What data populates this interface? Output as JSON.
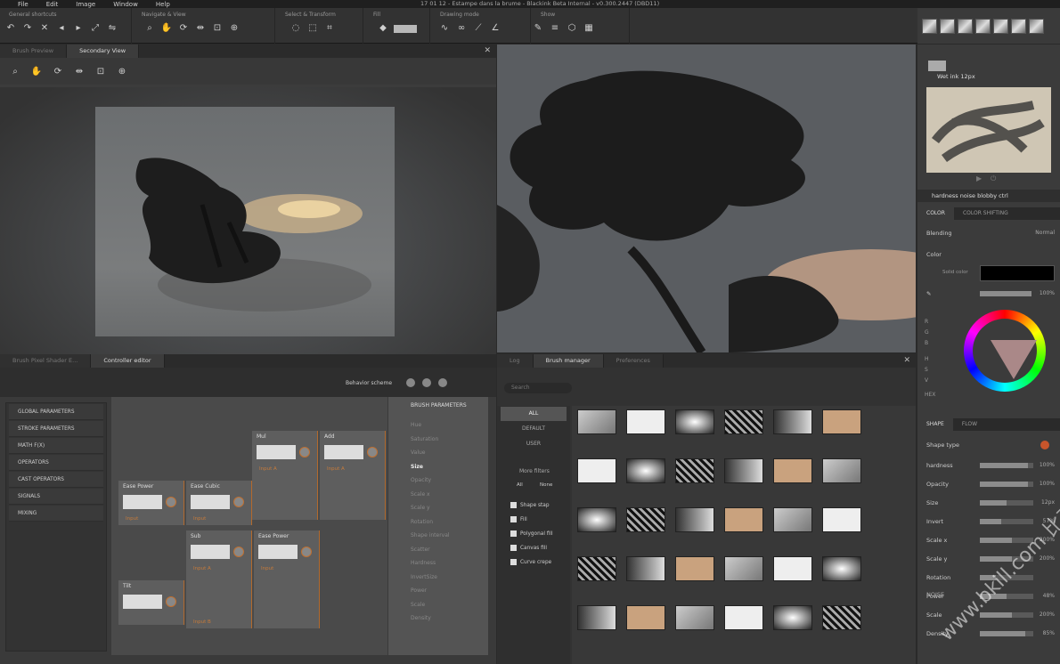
{
  "menu": {
    "items": [
      "File",
      "Edit",
      "Image",
      "Window",
      "Help"
    ],
    "title": "17 01 12 - Estampe dans la brume - Blackink Beta Internal - v0.300.2447 (DBD11)"
  },
  "toolbar": {
    "groups": [
      "General shortcuts",
      "Navigate & View",
      "Select & Transform",
      "Fill",
      "Drawing mode",
      "Show"
    ]
  },
  "left_top": {
    "tabs": [
      "Brush Preview",
      "Secondary View"
    ]
  },
  "ctrl": {
    "tabs": [
      "Brush Pixel Shader E...",
      "Controller editor"
    ],
    "behavior": "Behavior scheme",
    "left_items": [
      "GLOBAL PARAMETERS",
      "STROKE PARAMETERS",
      "MATH F(X)",
      "OPERATORS",
      "CAST OPERATORS",
      "SIGNALS",
      "MIXING"
    ],
    "nodes": {
      "mul": "Mul",
      "add": "Add",
      "ease_power": "Ease Power",
      "ease_cubic": "Ease Cubic",
      "sub": "Sub",
      "ease_power2": "Ease Power",
      "tilt": "Tilt",
      "input": "Input",
      "input_a": "Input A",
      "input_b": "Input B"
    },
    "bp_title": "BRUSH PARAMETERS",
    "bp_items": [
      "Hue",
      "Saturation",
      "Value",
      "Size",
      "Opacity",
      "Scale x",
      "Scale y",
      "Rotation",
      "Shape interval",
      "Scatter",
      "Hardness",
      "InvertSize",
      "Power",
      "Scale",
      "Density"
    ]
  },
  "bm": {
    "tabs": [
      "Log",
      "Brush manager",
      "Preferences"
    ],
    "search": "Search",
    "cats": [
      "ALL",
      "DEFAULT",
      "USER"
    ],
    "more": "More filters",
    "all": "All",
    "none": "None",
    "filters": [
      "Shape stap",
      "Fill",
      "Polygonal fill",
      "Canvas fill",
      "Curve crepe"
    ]
  },
  "right": {
    "wet": "Wet ink 12px",
    "brushname": "hardness noise blobby ctrl",
    "tabs1": [
      "COLOR",
      "COLOR SHIFTING"
    ],
    "blending": "Blending",
    "blend_val": "Normal",
    "color": "Color",
    "solid": "Solid color",
    "pct": "100%",
    "rgb": [
      "R",
      "G",
      "B",
      "H",
      "S",
      "V",
      "HEX"
    ],
    "tabs2": [
      "SHAPE",
      "FLOW"
    ],
    "shape_type": "Shape type",
    "rows": [
      {
        "k": "hardness",
        "v": "100%",
        "f": 0.9
      },
      {
        "k": "Opacity",
        "v": "100%",
        "f": 0.9
      },
      {
        "k": "Size",
        "v": "12px",
        "f": 0.5
      },
      {
        "k": "Invert",
        "v": "57%",
        "f": 0.4
      },
      {
        "k": "Scale x",
        "v": "200%",
        "f": 0.6
      },
      {
        "k": "Scale y",
        "v": "200%",
        "f": 0.6
      },
      {
        "k": "Rotation",
        "v": "",
        "f": 0.3
      },
      {
        "k": "Power",
        "v": "48%",
        "f": 0.5
      },
      {
        "k": "Scale",
        "v": "200%",
        "f": 0.6
      },
      {
        "k": "Density",
        "v": "85%",
        "f": 0.85
      }
    ],
    "noise": "NOISE"
  },
  "watermark": "www.bkill.com 比克尔下载 比克尔下载",
  "colors": {
    "accent": "#c87533",
    "bg": "#2a2a2a"
  }
}
